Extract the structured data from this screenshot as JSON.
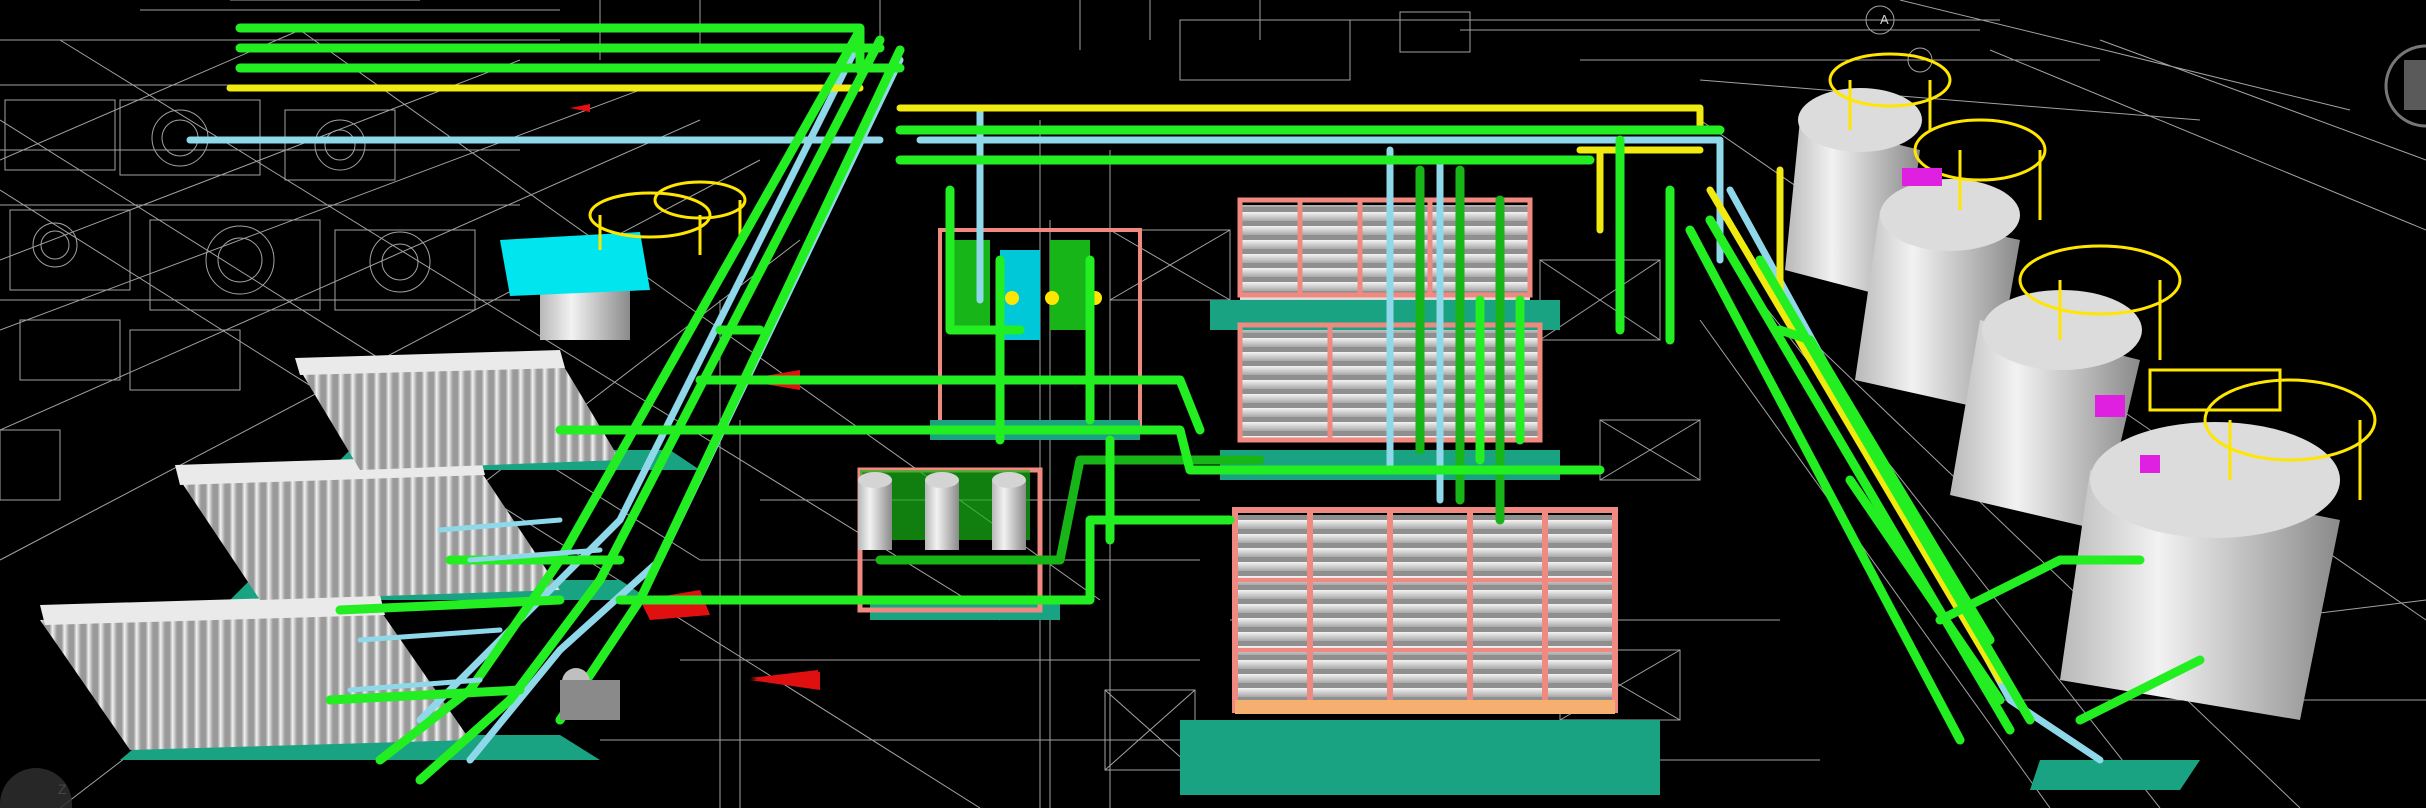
{
  "viewport": {
    "description_type": "3d-plant-model",
    "background": "#000000",
    "colors": {
      "drawing_lines": "#d8d8d8",
      "pipe_green": "#22ee22",
      "pipe_dark_green": "#17b517",
      "pipe_blue": "#8fd8ea",
      "pipe_yellow": "#f0ea10",
      "frame_pink": "#f08a80",
      "base_teal": "#19a383",
      "vessel_white": "#e6e6e6",
      "vessel_shadow": "#9a9a9a",
      "platform_yellow": "#ffe600",
      "accent_magenta": "#e020e0",
      "accent_red": "#e01010",
      "accent_cyan": "#00e5ee"
    }
  },
  "overlay": {
    "compass_label": "Z",
    "view_label": "A"
  },
  "icons": {
    "nav_cube": "view-cube-icon",
    "compass": "compass-icon"
  }
}
